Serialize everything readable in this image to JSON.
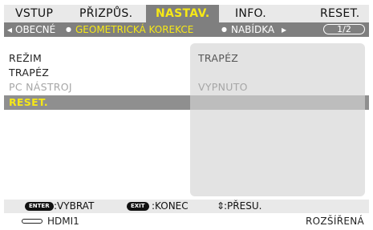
{
  "tabs": [
    {
      "label": "VSTUP",
      "active": false
    },
    {
      "label": "PŘIZPŮS.",
      "active": false
    },
    {
      "label": "NASTAV.",
      "active": true
    },
    {
      "label": "INFO.",
      "active": false
    },
    {
      "label": "RESET.",
      "active": false
    }
  ],
  "subtabs": {
    "items": [
      {
        "label": "OBECNÉ",
        "selected": false
      },
      {
        "label": "GEOMETRICKÁ KOREKCE",
        "selected": true
      },
      {
        "label": "NABÍDKA",
        "selected": false
      }
    ],
    "left_arrow": "◂",
    "bullet": "●",
    "right_arrow": "▸",
    "page": "1/2"
  },
  "menu": [
    {
      "label": "REŽIM",
      "value": "TRAPÉZ",
      "state": "normal"
    },
    {
      "label": "TRAPÉZ",
      "value": "",
      "state": "normal"
    },
    {
      "label": "PC NÁSTROJ",
      "value": "VYPNUTO",
      "state": "disabled"
    },
    {
      "label": "RESET.",
      "value": "",
      "state": "selected"
    }
  ],
  "help": {
    "enter_key": "ENTER",
    "enter_text": ":VYBRAT",
    "exit_key": "EXIT",
    "exit_text": ":KONEC",
    "move_symbol": "⇕",
    "move_text": ":PŘESU."
  },
  "footer": {
    "source": "HDMI1",
    "menu_mode": "ROZŠÍŘENÁ"
  },
  "colors": {
    "highlight": "#f6e816",
    "bar_gray": "#7f7f7f",
    "panel_gray": "#e3e3e3"
  }
}
